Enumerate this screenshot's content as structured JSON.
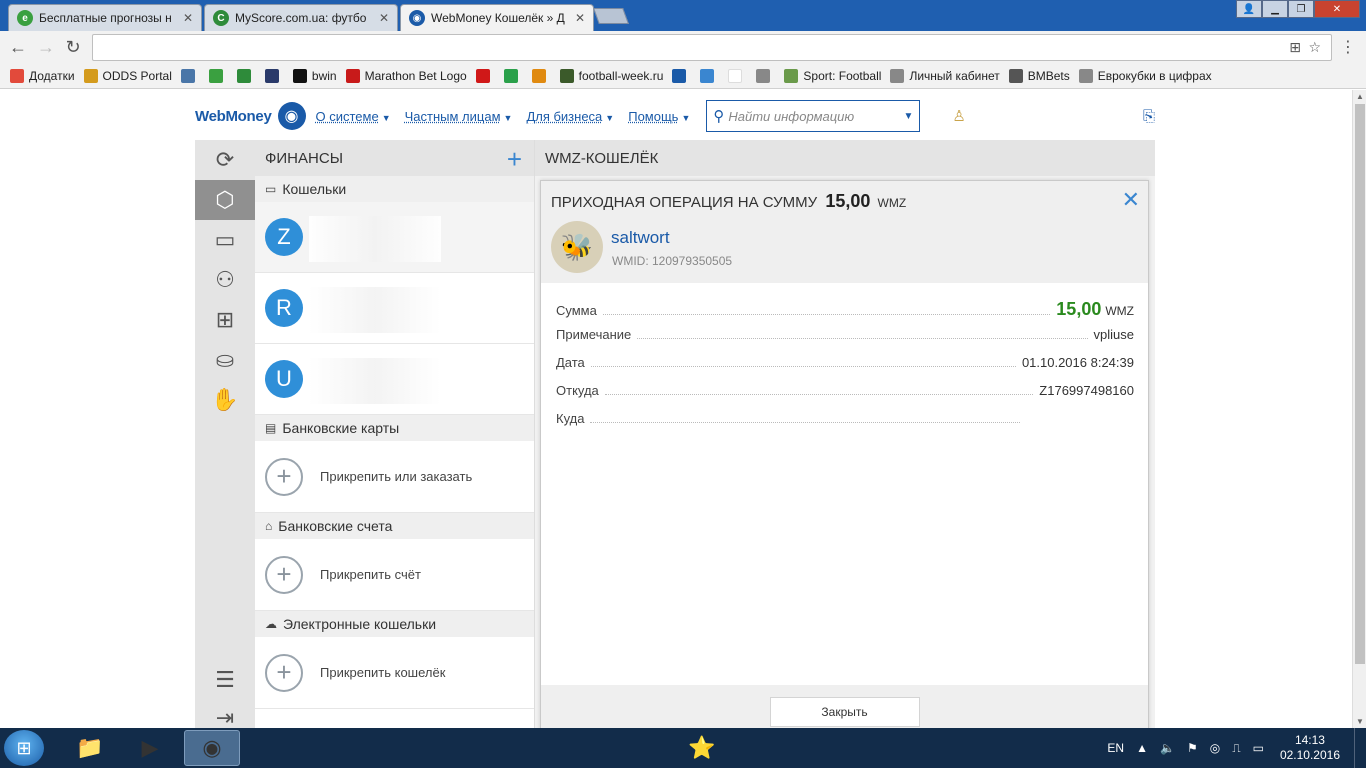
{
  "browser": {
    "tabs": [
      {
        "title": "Бесплатные прогнозы н",
        "color": "#3aa040",
        "glyph": "e"
      },
      {
        "title": "MyScore.com.ua: футбо",
        "color": "#2e8b3a",
        "glyph": "C"
      },
      {
        "title": "WebMoney Кошелёк » Д",
        "color": "#1a5aa8",
        "glyph": "◉"
      }
    ],
    "bookmarks": [
      {
        "label": "Додатки",
        "color": "#e24a3b"
      },
      {
        "label": "ODDS Portal",
        "color": "#d49b1d"
      },
      {
        "label": "",
        "color": "#4a76a8"
      },
      {
        "label": "",
        "color": "#3aa040"
      },
      {
        "label": "",
        "color": "#2e8b3a"
      },
      {
        "label": "",
        "color": "#2a3a6a"
      },
      {
        "label": "bwin",
        "color": "#111111"
      },
      {
        "label": "Marathon Bet Logo",
        "color": "#c81a1a"
      },
      {
        "label": "",
        "color": "#d01818"
      },
      {
        "label": "",
        "color": "#2aa04a"
      },
      {
        "label": "",
        "color": "#e08a10"
      },
      {
        "label": "football-week.ru",
        "color": "#3b5a2a"
      },
      {
        "label": "",
        "color": "#1a5aa8"
      },
      {
        "label": "",
        "color": "#3a86d0"
      },
      {
        "label": "",
        "color": "#ffffff"
      },
      {
        "label": "",
        "color": "#888888"
      },
      {
        "label": "Sport: Football",
        "color": "#6a9a4a"
      },
      {
        "label": "Личный кабинет",
        "color": "#888888"
      },
      {
        "label": "BMBets",
        "color": "#555555"
      },
      {
        "label": "Еврокубки в цифрах",
        "color": "#888888"
      }
    ]
  },
  "header": {
    "logo": "WebMoney",
    "nav": [
      "О системе",
      "Частным лицам",
      "Для бизнеса",
      "Помощь"
    ],
    "search_placeholder": "Найти информацию"
  },
  "finance": {
    "title": "ФИНАНСЫ",
    "wallets_group": "Кошельки",
    "wallets": [
      "Z",
      "R",
      "U"
    ],
    "cards_group": "Банковские карты",
    "cards_action": "Прикрепить или заказать",
    "accounts_group": "Банковские счета",
    "accounts_action": "Прикрепить счёт",
    "ewallets_group": "Электронные кошельки",
    "ewallets_action": "Прикрепить кошелёк"
  },
  "wallet_panel": {
    "title": "WMZ-КОШЕЛЁК"
  },
  "operation": {
    "title": "ПРИХОДНАЯ ОПЕРАЦИЯ НА СУММУ",
    "amount": "15,00",
    "currency": "WMZ",
    "sender_name": "saltwort",
    "sender_wmid": "WMID: 120979350505",
    "rows": [
      {
        "key": "Сумма",
        "value": "15,00",
        "currency": "WMZ"
      },
      {
        "key": "Примечание",
        "value": "vpliuse"
      },
      {
        "key": "Дата",
        "value": "01.10.2016 8:24:39"
      },
      {
        "key": "Откуда",
        "value": "Z176997498160"
      },
      {
        "key": "Куда",
        "value": ""
      }
    ],
    "close_label": "Закрыть"
  },
  "taskbar": {
    "lang": "EN",
    "time": "14:13",
    "date": "02.10.2016"
  },
  "colors": {
    "brand": "#1a5aa8",
    "accent": "#3a86d0",
    "income": "#2a8a1e"
  }
}
